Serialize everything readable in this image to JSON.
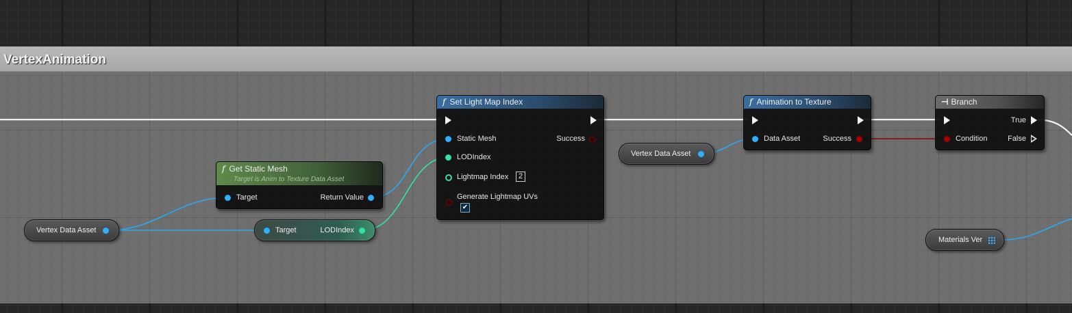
{
  "comment": {
    "title": "VertexAnimation"
  },
  "nodes": {
    "get_static_mesh": {
      "title": "Get Static Mesh",
      "subtitle": "Target is Anim to Texture Data Asset",
      "pins": {
        "target": "Target",
        "return_value": "Return Value"
      }
    },
    "set_light_map_index": {
      "title": "Set Light Map Index",
      "pins": {
        "static_mesh": "Static Mesh",
        "success": "Success",
        "lod_index": "LODIndex",
        "lightmap_index": "Lightmap Index",
        "lightmap_index_value": "2",
        "generate_lightmap_uvs": "Generate Lightmap UVs",
        "generate_checked": true
      }
    },
    "animation_to_texture": {
      "title": "Animation to Texture",
      "pins": {
        "data_asset": "Data Asset",
        "success": "Success"
      }
    },
    "branch": {
      "title": "Branch",
      "pins": {
        "condition": "Condition",
        "true": "True",
        "false": "False"
      }
    },
    "vertex_data_asset_1": {
      "label": "Vertex Data Asset"
    },
    "vertex_data_asset_2": {
      "label": "Vertex Data Asset"
    },
    "lod_break": {
      "target": "Target",
      "lod_index": "LODIndex"
    },
    "materials_var": {
      "label": "Materials Ver"
    }
  },
  "colors": {
    "object_pin": "#2cb0ff",
    "struct_pin": "#33e0a8",
    "bool_pin": "#a30000",
    "exec_wire": "#ffffff",
    "function_header": "#3b6ea0",
    "pure_header": "#5f8a4b"
  },
  "icons": {
    "function": "function-f-icon",
    "branch": "branch-icon",
    "array": "array-grid-icon",
    "checkbox": "checkmark-icon"
  }
}
